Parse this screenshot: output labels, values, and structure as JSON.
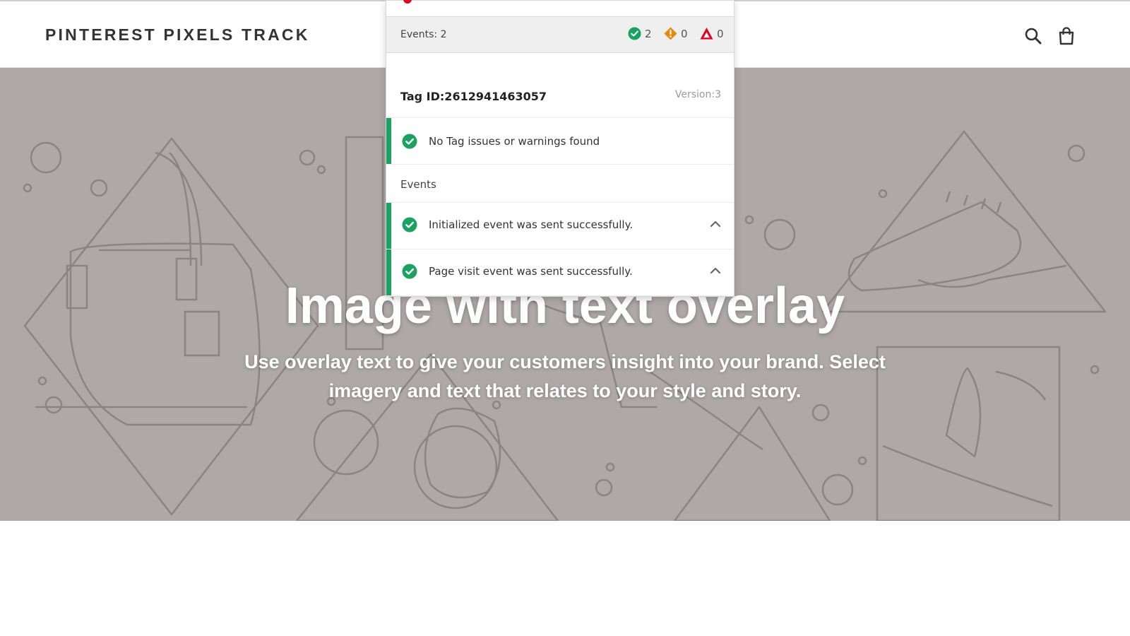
{
  "store": {
    "title": "PINTEREST PIXELS TRACK",
    "icons": {
      "search": "search-icon",
      "cart": "cart-icon"
    }
  },
  "hero": {
    "title": "Image with text overlay",
    "subtitle": "Use overlay text to give your customers insight into your brand. Select imagery and text that relates to your style and story."
  },
  "tag_helper": {
    "events_summary": "Events: 2",
    "counts": {
      "success": "2",
      "warning": "0",
      "error": "0"
    },
    "tag_id": "Tag ID:2612941463057",
    "version": "Version:3",
    "status_message": "No Tag issues or warnings found",
    "events_heading": "Events",
    "events": [
      {
        "message": "Initialized event was sent successfully."
      },
      {
        "message": "Page visit event was sent successfully."
      }
    ],
    "colors": {
      "success": "#1aa260",
      "warning": "#e8890c",
      "error": "#e60023"
    }
  }
}
